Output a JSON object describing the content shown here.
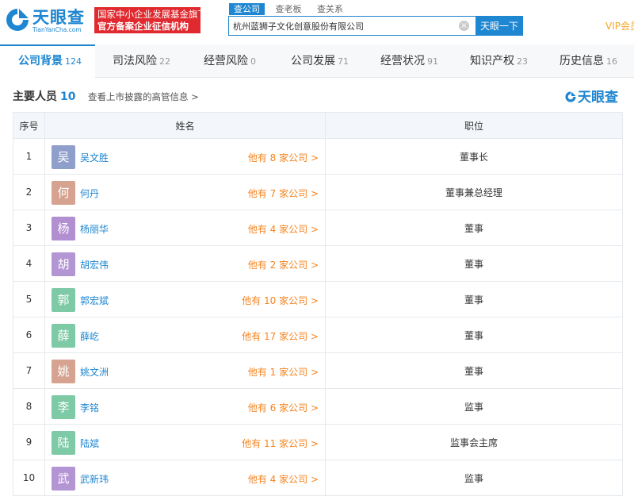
{
  "header": {
    "logo_text": "天眼查",
    "logo_sub": "TianYanCha.com",
    "promo_line1": "国家中小企业发展基金旗下",
    "promo_line2": "官方备案企业征信机构",
    "search_tabs": [
      "查公司",
      "查老板",
      "查关系"
    ],
    "search_value": "杭州蓝狮子文化创意股份有限公司",
    "clear_icon": "clear-icon",
    "search_button": "天眼一下",
    "vip": "VIP会员"
  },
  "nav": [
    {
      "label": "公司背景",
      "count": "124"
    },
    {
      "label": "司法风险",
      "count": "22"
    },
    {
      "label": "经营风险",
      "count": "0"
    },
    {
      "label": "公司发展",
      "count": "71"
    },
    {
      "label": "经营状况",
      "count": "91"
    },
    {
      "label": "知识产权",
      "count": "23"
    },
    {
      "label": "历史信息",
      "count": "16"
    }
  ],
  "section": {
    "title": "主要人员",
    "count": "10",
    "link": "查看上市披露的高管信息 >",
    "brand": "天眼查"
  },
  "table": {
    "headers": [
      "序号",
      "姓名",
      "职位"
    ],
    "rows": [
      {
        "no": "1",
        "avatar": "吴",
        "avatar_color": "#8e9fcb",
        "name": "吴文胜",
        "companies": "他有 8 家公司 >",
        "position": "董事长"
      },
      {
        "no": "2",
        "avatar": "何",
        "avatar_color": "#d6a391",
        "name": "何丹",
        "companies": "他有 7 家公司 >",
        "position": "董事兼总经理"
      },
      {
        "no": "3",
        "avatar": "杨",
        "avatar_color": "#b28fd1",
        "name": "杨丽华",
        "companies": "他有 4 家公司 >",
        "position": "董事"
      },
      {
        "no": "4",
        "avatar": "胡",
        "avatar_color": "#b495d4",
        "name": "胡宏伟",
        "companies": "他有 2 家公司 >",
        "position": "董事"
      },
      {
        "no": "5",
        "avatar": "郭",
        "avatar_color": "#7ecaa6",
        "name": "郭宏斌",
        "companies": "他有 10 家公司 >",
        "position": "董事"
      },
      {
        "no": "6",
        "avatar": "薛",
        "avatar_color": "#7ecaa6",
        "name": "薛屹",
        "companies": "他有 17 家公司 >",
        "position": "董事"
      },
      {
        "no": "7",
        "avatar": "姚",
        "avatar_color": "#d6a391",
        "name": "姚文洲",
        "companies": "他有 1 家公司 >",
        "position": "董事"
      },
      {
        "no": "8",
        "avatar": "李",
        "avatar_color": "#7ecaa6",
        "name": "李铭",
        "companies": "他有 6 家公司 >",
        "position": "监事"
      },
      {
        "no": "9",
        "avatar": "陆",
        "avatar_color": "#7ecaa6",
        "name": "陆斌",
        "companies": "他有 11 家公司 >",
        "position": "监事会主席"
      },
      {
        "no": "10",
        "avatar": "武",
        "avatar_color": "#b495d4",
        "name": "武新玮",
        "companies": "他有 4 家公司 >",
        "position": "监事"
      }
    ]
  }
}
